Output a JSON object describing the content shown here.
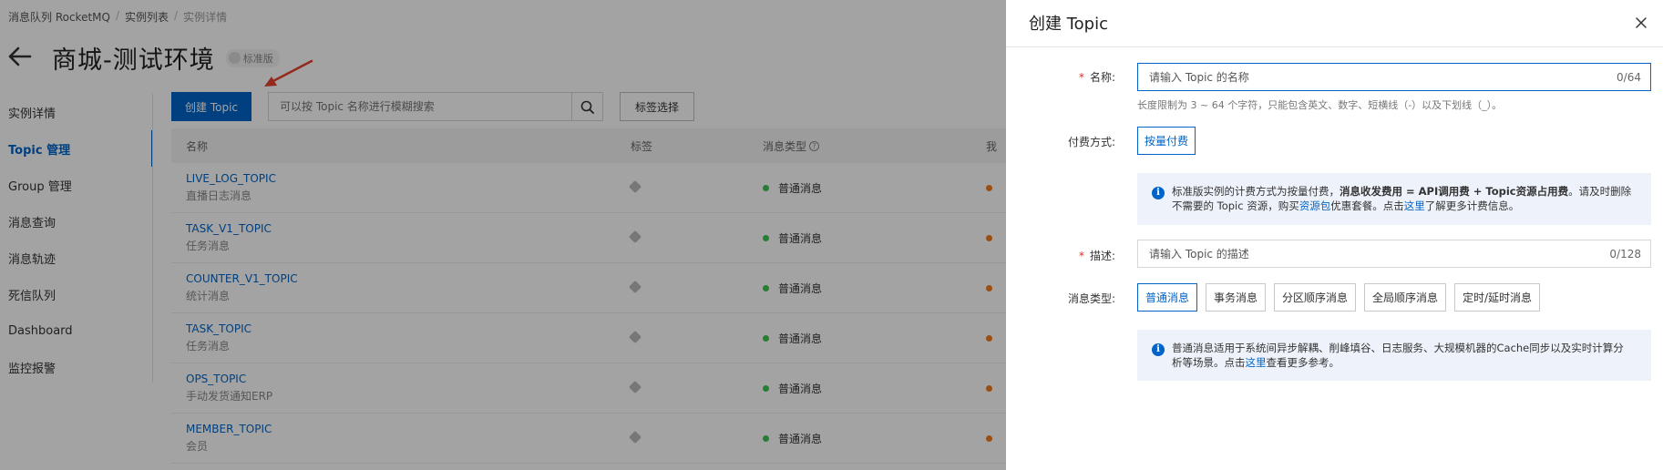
{
  "breadcrumb": [
    "消息队列 RocketMQ",
    "实例列表",
    "实例详情"
  ],
  "page": {
    "title": "商城-测试环境",
    "edition_badge": "标准版"
  },
  "sidenav": [
    {
      "label": "实例详情",
      "active": false
    },
    {
      "label": "Topic 管理",
      "active": true
    },
    {
      "label": "Group 管理",
      "active": false
    },
    {
      "label": "消息查询",
      "active": false
    },
    {
      "label": "消息轨迹",
      "active": false
    },
    {
      "label": "死信队列",
      "active": false
    },
    {
      "label": "Dashboard",
      "active": false
    },
    {
      "label": "监控报警",
      "active": false
    }
  ],
  "toolbar": {
    "create_label": "创建 Topic",
    "search_placeholder": "可以按 Topic 名称进行模糊搜索",
    "tag_filter_label": "标签选择"
  },
  "table": {
    "headers": {
      "name": "名称",
      "tags": "标签",
      "type": "消息类型",
      "more": "我"
    },
    "rows": [
      {
        "name": "LIVE_LOG_TOPIC",
        "desc": "直播日志消息",
        "type": "普通消息"
      },
      {
        "name": "TASK_V1_TOPIC",
        "desc": "任务消息",
        "type": "普通消息"
      },
      {
        "name": "COUNTER_V1_TOPIC",
        "desc": "统计消息",
        "type": "普通消息"
      },
      {
        "name": "TASK_TOPIC",
        "desc": "任务消息",
        "type": "普通消息"
      },
      {
        "name": "OPS_TOPIC",
        "desc": "手动发货通知ERP",
        "type": "普通消息"
      },
      {
        "name": "MEMBER_TOPIC",
        "desc": "会员",
        "type": "普通消息"
      }
    ]
  },
  "drawer": {
    "title": "创建 Topic",
    "name_field": {
      "label": "名称:",
      "placeholder": "请输入 Topic 的名称",
      "counter": "0/64",
      "hint": "长度限制为 3 ~ 64 个字符，只能包含英文、数字、短横线（-）以及下划线（_）。"
    },
    "billing": {
      "label": "付费方式:",
      "option": "按量付费",
      "info_1": "标准版实例的计费方式为按量付费，",
      "info_bold": "消息收发费用 = API调用费 + Topic资源占用费",
      "info_2": "。请及时删除不需要的 Topic 资源，购买",
      "info_link1": "资源包",
      "info_3": "优惠套餐。点击",
      "info_link2": "这里",
      "info_4": "了解更多计费信息。"
    },
    "desc_field": {
      "label": "描述:",
      "placeholder": "请输入 Topic 的描述",
      "counter": "0/128"
    },
    "msg_type": {
      "label": "消息类型:",
      "options": [
        "普通消息",
        "事务消息",
        "分区顺序消息",
        "全局顺序消息",
        "定时/延时消息"
      ],
      "selected": "普通消息",
      "info_1": "普通消息适用于系统间异步解耦、削峰填谷、日志服务、大规模机器的Cache同步以及实时计算分析等场景。点击",
      "info_link": "这里",
      "info_2": "查看更多参考。"
    }
  },
  "colors": {
    "primary": "#0064c8",
    "required": "#d93026",
    "status_green": "#3dc44f",
    "status_orange": "#f07a1e",
    "arrow_red": "#e8432e"
  }
}
